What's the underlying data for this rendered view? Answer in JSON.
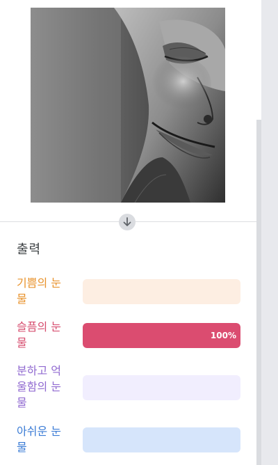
{
  "output": {
    "title": "출력",
    "rows": [
      {
        "label": "기쁨의 눈물",
        "score": 0.0,
        "percent_text": "",
        "label_color": "#e8922b",
        "bg_color": "#fdeee2",
        "fill_color": "#f5a25d"
      },
      {
        "label": "슬픔의 눈물",
        "score": 1.0,
        "percent_text": "100%",
        "label_color": "#d64c6e",
        "bg_color": "#f9dde4",
        "fill_color": "#db4c70"
      },
      {
        "label": "분하고 억울함의 눈물",
        "score": 0.0,
        "percent_text": "",
        "label_color": "#9069d0",
        "bg_color": "#f1eefe",
        "fill_color": "#9b7be0"
      },
      {
        "label": "아쉬운 눈물",
        "score": 0.0,
        "percent_text": "",
        "label_color": "#3a7bd5",
        "bg_color": "#d6e5fb",
        "fill_color": "#4d8fe6"
      }
    ]
  },
  "icons": {
    "arrow": "arrow-down-icon"
  }
}
